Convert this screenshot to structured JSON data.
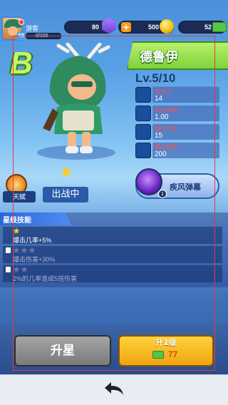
{
  "player": {
    "name": "游客",
    "level": "45",
    "xp": "0/100"
  },
  "resources": {
    "gems": "80",
    "gold": "500",
    "cash": "52"
  },
  "hero": {
    "rank": "B",
    "name": "德鲁伊",
    "level": "Lv.5/10"
  },
  "stats": [
    {
      "label": "攻击力",
      "value": "14",
      "icon": "sword-icon"
    },
    {
      "label": "攻击间隔",
      "value": "1.00",
      "icon": "attack-speed-icon"
    },
    {
      "label": "暴击几率",
      "value": "15",
      "icon": "crit-chance-icon"
    },
    {
      "label": "暴击伤害",
      "value": "200",
      "icon": "crit-damage-icon"
    }
  ],
  "actions": {
    "talent": "天赋",
    "deployed": "出战中",
    "skill_name": "疾风弹幕",
    "skill_level": "1"
  },
  "star_skills": {
    "title": "星级技能",
    "items": [
      {
        "stars": 1,
        "text": "爆击几率+5%",
        "locked": false
      },
      {
        "stars": 3,
        "text": "爆击伤害+30%",
        "locked": true
      },
      {
        "stars": 2,
        "text": "2%的几率造成5倍伤害",
        "locked": true
      }
    ]
  },
  "buttons": {
    "upgrade_star": "升星",
    "level_up": "升1级",
    "level_up_cost": "77"
  },
  "colors": {
    "accent_green": "#7fd23a",
    "gold": "#f0a312"
  }
}
